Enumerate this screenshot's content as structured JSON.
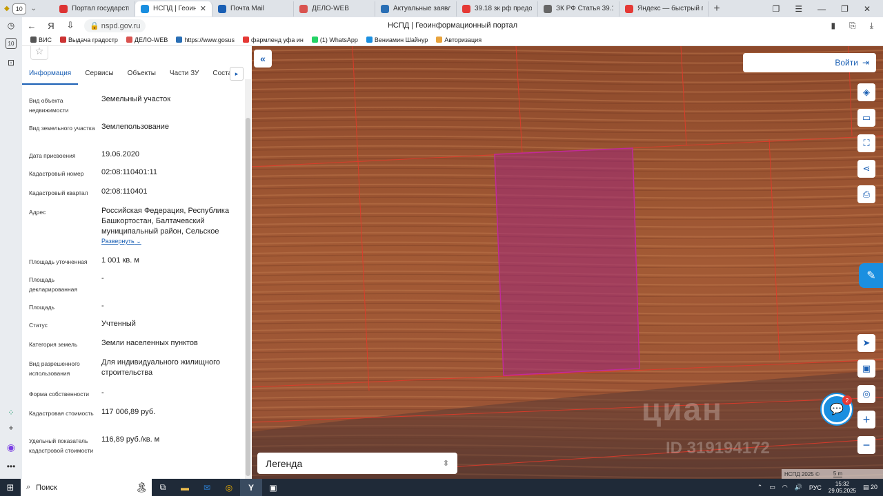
{
  "browser": {
    "tab_count": "10",
    "tabs": [
      {
        "title": "Портал государственн",
        "color": "#d33"
      },
      {
        "title": "НСПД | Геоинформ",
        "color": "#1a8fe0",
        "active": true
      },
      {
        "title": "Почта Mail",
        "color": "#1a5fb4"
      },
      {
        "title": "ДЕЛО-WEB",
        "color": "#d9534f"
      },
      {
        "title": "Актуальные заявлени",
        "color": "#2a6fb5"
      },
      {
        "title": "39.18 зк рф предостав",
        "color": "#e53935"
      },
      {
        "title": "ЗК РФ Статья 39.18. О",
        "color": "#666"
      },
      {
        "title": "Яндекс — быстрый по",
        "color": "#e53935"
      }
    ],
    "url": "nspd.gov.ru",
    "page_title": "НСПД | Геоинформационный портал",
    "bookmarks": [
      {
        "label": "ВИС",
        "color": "#555"
      },
      {
        "label": "Выдача градостр",
        "color": "#c33"
      },
      {
        "label": "ДЕЛО-WEB",
        "color": "#d9534f"
      },
      {
        "label": "https://www.gosus",
        "color": "#2a6fb5"
      },
      {
        "label": "фармленд уфа ин",
        "color": "#e53935"
      },
      {
        "label": "(1) WhatsApp",
        "color": "#25d366"
      },
      {
        "label": "Вениамин Шайнур",
        "color": "#1a8fe0"
      },
      {
        "label": "Авторизация",
        "color": "#e8a33d"
      }
    ]
  },
  "panel": {
    "tabs": [
      "Информация",
      "Сервисы",
      "Объекты",
      "Части ЗУ",
      "Соста"
    ],
    "expand_label": "Развернуть",
    "rows": [
      {
        "label": "Вид объекта недвижимости",
        "value": "Земельный участок"
      },
      {
        "label": "Вид земельного участка",
        "value": "Землепользование"
      },
      {
        "label": "Дата присвоения",
        "value": "19.06.2020"
      },
      {
        "label": "Кадастровый номер",
        "value": "02:08:110401:11"
      },
      {
        "label": "Кадастровый квартал",
        "value": "02:08:110401"
      },
      {
        "label": "Адрес",
        "value": "Российская Федерация, Республика Башкортостан, Балтачевский муниципальный район, Сельское"
      },
      {
        "label": "Площадь уточненная",
        "value": "1 001 кв. м"
      },
      {
        "label": "Площадь декларированная",
        "value": "-"
      },
      {
        "label": "Площадь",
        "value": "-"
      },
      {
        "label": "Статус",
        "value": "Учтенный"
      },
      {
        "label": "Категория земель",
        "value": "Земли населенных пунктов"
      },
      {
        "label": "Вид разрешенного использования",
        "value": "Для индивидуального жилищного строительства"
      },
      {
        "label": "Форма собственности",
        "value": "-"
      },
      {
        "label": "Кадастровая стоимость",
        "value": "117 006,89 руб."
      },
      {
        "label": "Удельный показатель кадастровой стоимости",
        "value": "116,89 руб./кв. м"
      }
    ]
  },
  "map": {
    "login_label": "Войти",
    "legend_label": "Легенда",
    "watermark": "циан",
    "watermark_id": "ID 319194172",
    "attribution": "НСПД 2025 ©",
    "scale": "5 m",
    "chat_badge": "2",
    "parcel_color": "#a0287a"
  },
  "taskbar": {
    "search_label": "Поиск",
    "lang": "РУС",
    "time": "15:32",
    "date": "29.05.2025",
    "notifications": "20"
  }
}
